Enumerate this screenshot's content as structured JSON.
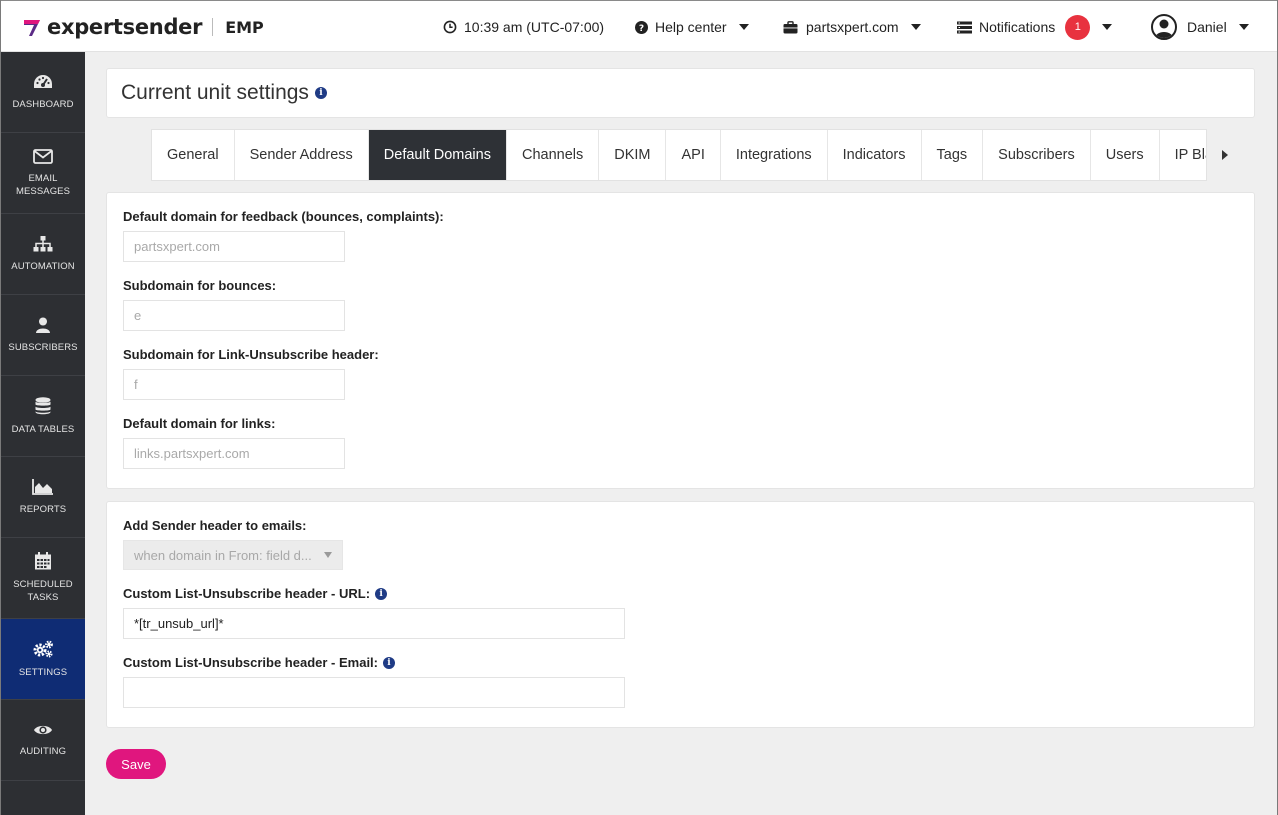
{
  "brand": {
    "name": "expertsender",
    "product": "EMP"
  },
  "topbar": {
    "time": "10:39 am (UTC-07:00)",
    "help": "Help center",
    "account": "partsxpert.com",
    "notifications": "Notifications",
    "notif_count": "1",
    "user": "Daniel"
  },
  "sidebar": {
    "items": [
      {
        "label": "Dashboard",
        "icon": "dashboard-icon"
      },
      {
        "label": "Email messages",
        "icon": "envelope-icon"
      },
      {
        "label": "Automation",
        "icon": "sitemap-icon"
      },
      {
        "label": "Subscribers",
        "icon": "user-icon"
      },
      {
        "label": "Data tables",
        "icon": "database-icon"
      },
      {
        "label": "Reports",
        "icon": "area-chart-icon"
      },
      {
        "label": "Scheduled tasks",
        "icon": "calendar-icon"
      },
      {
        "label": "Settings",
        "icon": "gears-icon",
        "active": true
      },
      {
        "label": "Auditing",
        "icon": "eye-icon"
      }
    ]
  },
  "page": {
    "title": "Current unit settings"
  },
  "tabs": [
    {
      "label": "General"
    },
    {
      "label": "Sender Address"
    },
    {
      "label": "Default Domains",
      "active": true
    },
    {
      "label": "Channels"
    },
    {
      "label": "DKIM"
    },
    {
      "label": "API"
    },
    {
      "label": "Integrations"
    },
    {
      "label": "Indicators"
    },
    {
      "label": "Tags"
    },
    {
      "label": "Subscribers"
    },
    {
      "label": "Users"
    },
    {
      "label": "IP Blackli"
    }
  ],
  "domains": {
    "feedback_label": "Default domain for feedback (bounces, complaints):",
    "feedback_placeholder": "partsxpert.com",
    "bounces_label": "Subdomain for bounces:",
    "bounces_placeholder": "e",
    "unsub_label": "Subdomain for Link-Unsubscribe header:",
    "unsub_placeholder": "f",
    "links_label": "Default domain for links:",
    "links_placeholder": "links.partsxpert.com"
  },
  "headers": {
    "sender_label": "Add Sender header to emails:",
    "sender_value": "when domain in From: field d...",
    "url_label": "Custom List-Unsubscribe header - URL:",
    "url_value": "*[tr_unsub_url]*",
    "email_label": "Custom List-Unsubscribe header - Email:",
    "email_value": ""
  },
  "actions": {
    "save": "Save"
  },
  "colors": {
    "accent": "#e0167e",
    "sidebar": "#2d2f33",
    "active": "#0f2c74",
    "badge": "#e8323f"
  }
}
